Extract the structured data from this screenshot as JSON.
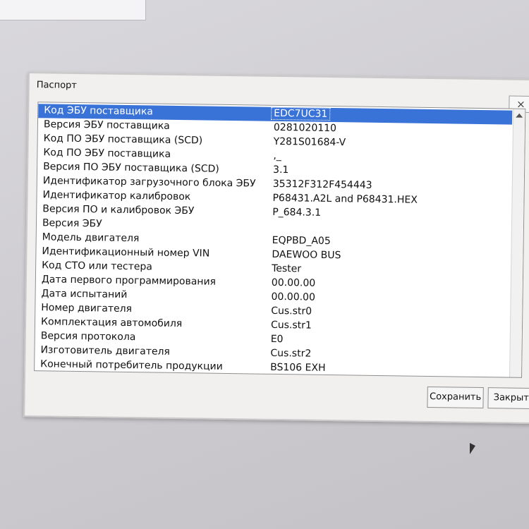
{
  "dialog": {
    "title": "Паспорт",
    "close_symbol": "×",
    "buttons": {
      "save_label": "Сохранить",
      "close_label": "Закрыть"
    },
    "fields": [
      {
        "label": "Код ЭБУ поставщика",
        "value": "EDC7UC31"
      },
      {
        "label": "Версия ЭБУ поставщика",
        "value": "0281020110"
      },
      {
        "label": "Код ПО ЭБУ поставщика (SCD)",
        "value": "Y281S01684-V"
      },
      {
        "label": "Код ПО ЭБУ поставщика",
        "value": ",_"
      },
      {
        "label": "Версия ПО ЭБУ поставщика (SCD)",
        "value": "3.1"
      },
      {
        "label": "Идентификатор загрузочного блока ЭБУ",
        "value": "35312F312F454443"
      },
      {
        "label": "Идентификатор калибровок",
        "value": "P68431.A2L and P68431.HEX"
      },
      {
        "label": "Версия ПО и калибровок ЭБУ",
        "value": "P_684.3.1"
      },
      {
        "label": "Версия ЭБУ",
        "value": ""
      },
      {
        "label": "Модель двигателя",
        "value": "EQPBD_A05"
      },
      {
        "label": "Идентификационный номер VIN",
        "value": "DAEWOO BUS"
      },
      {
        "label": "Код СТО или тестера",
        "value": "Tester"
      },
      {
        "label": "Дата первого программирования",
        "value": "00.00.00"
      },
      {
        "label": "Дата испытаний",
        "value": "00.00.00"
      },
      {
        "label": "Номер двигателя",
        "value": "Cus.str0"
      },
      {
        "label": "Комплектация автомобиля",
        "value": "Cus.str1"
      },
      {
        "label": "Версия протокола",
        "value": "E0"
      },
      {
        "label": "Изготовитель двигателя",
        "value": "Cus.str2"
      },
      {
        "label": "Конечный потребитель продукции",
        "value": "BS106 EXH"
      }
    ]
  }
}
